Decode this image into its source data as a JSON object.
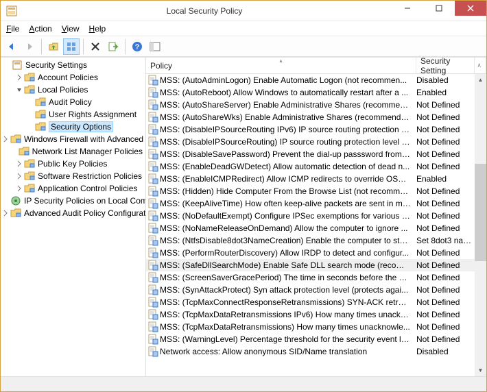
{
  "window": {
    "title": "Local Security Policy"
  },
  "menus": {
    "file": "File",
    "action": "Action",
    "view": "View",
    "help": "Help"
  },
  "toolbar": {
    "back": "back-icon",
    "forward": "forward-icon",
    "up": "up-folder-icon",
    "view_toggle": "view-thumbnails-icon",
    "delete": "delete-icon",
    "export": "export-icon",
    "help": "help-icon",
    "panel": "panel-icon"
  },
  "tree": {
    "root": {
      "label": "Security Settings",
      "expanded": true
    },
    "items": [
      {
        "label": "Account Policies",
        "level": 1,
        "exp": "right"
      },
      {
        "label": "Local Policies",
        "level": 1,
        "exp": "down"
      },
      {
        "label": "Audit Policy",
        "level": 2,
        "exp": "none"
      },
      {
        "label": "User Rights Assignment",
        "level": 2,
        "exp": "none"
      },
      {
        "label": "Security Options",
        "level": 2,
        "exp": "none",
        "selected": true
      },
      {
        "label": "Windows Firewall with Advanced Security",
        "level": 1,
        "exp": "right"
      },
      {
        "label": "Network List Manager Policies",
        "level": 1,
        "exp": "none"
      },
      {
        "label": "Public Key Policies",
        "level": 1,
        "exp": "right"
      },
      {
        "label": "Software Restriction Policies",
        "level": 1,
        "exp": "right"
      },
      {
        "label": "Application Control Policies",
        "level": 1,
        "exp": "right"
      },
      {
        "label": "IP Security Policies on Local Computer",
        "level": 1,
        "exp": "none",
        "icon": "ipsec"
      },
      {
        "label": "Advanced Audit Policy Configuration",
        "level": 1,
        "exp": "right"
      }
    ]
  },
  "list": {
    "columns": {
      "policy": "Policy",
      "setting": "Security Setting"
    },
    "rows": [
      {
        "policy": "MSS: (AutoAdminLogon) Enable Automatic Logon (not recommen...",
        "setting": "Disabled"
      },
      {
        "policy": "MSS: (AutoReboot) Allow Windows to automatically restart after a ...",
        "setting": "Enabled"
      },
      {
        "policy": "MSS: (AutoShareServer) Enable Administrative Shares (recommend...",
        "setting": "Not Defined"
      },
      {
        "policy": "MSS: (AutoShareWks) Enable Administrative Shares (recommende...",
        "setting": "Not Defined"
      },
      {
        "policy": "MSS: (DisableIPSourceRouting IPv6) IP source routing protection le...",
        "setting": "Not Defined"
      },
      {
        "policy": "MSS: (DisableIPSourceRouting) IP source routing protection level (...",
        "setting": "Not Defined"
      },
      {
        "policy": "MSS: (DisableSavePassword) Prevent the dial-up passsword from b...",
        "setting": "Not Defined"
      },
      {
        "policy": "MSS: (EnableDeadGWDetect) Allow automatic detection of dead n...",
        "setting": "Not Defined"
      },
      {
        "policy": "MSS: (EnableICMPRedirect) Allow ICMP redirects to override OSPF ...",
        "setting": "Enabled"
      },
      {
        "policy": "MSS: (Hidden) Hide Computer From the Browse List (not recomme...",
        "setting": "Not Defined"
      },
      {
        "policy": "MSS: (KeepAliveTime) How often keep-alive packets are sent in mil...",
        "setting": "Not Defined"
      },
      {
        "policy": "MSS: (NoDefaultExempt) Configure IPSec exemptions for various ty...",
        "setting": "Not Defined"
      },
      {
        "policy": "MSS: (NoNameReleaseOnDemand) Allow the computer to ignore ...",
        "setting": "Not Defined"
      },
      {
        "policy": "MSS: (NtfsDisable8dot3NameCreation) Enable the computer to sto...",
        "setting": "Set 8dot3 nam..."
      },
      {
        "policy": "MSS: (PerformRouterDiscovery) Allow IRDP to detect and configur...",
        "setting": "Not Defined"
      },
      {
        "policy": "MSS: (SafeDllSearchMode) Enable Safe DLL search mode (recomm...",
        "setting": "Not Defined",
        "selected": true
      },
      {
        "policy": "MSS: (ScreenSaverGracePeriod) The time in seconds before the scr...",
        "setting": "Not Defined"
      },
      {
        "policy": "MSS: (SynAttackProtect) Syn attack protection level (protects agai...",
        "setting": "Not Defined"
      },
      {
        "policy": "MSS: (TcpMaxConnectResponseRetransmissions) SYN-ACK retrans...",
        "setting": "Not Defined"
      },
      {
        "policy": "MSS: (TcpMaxDataRetransmissions IPv6) How many times unackn...",
        "setting": "Not Defined"
      },
      {
        "policy": "MSS: (TcpMaxDataRetransmissions) How many times unacknowle...",
        "setting": "Not Defined"
      },
      {
        "policy": "MSS: (WarningLevel) Percentage threshold for the security event lo...",
        "setting": "Not Defined"
      },
      {
        "policy": "Network access: Allow anonymous SID/Name translation",
        "setting": "Disabled"
      }
    ]
  },
  "colors": {
    "border": "#d6a13a",
    "close": "#c75050",
    "selection": "#cce8ff"
  }
}
